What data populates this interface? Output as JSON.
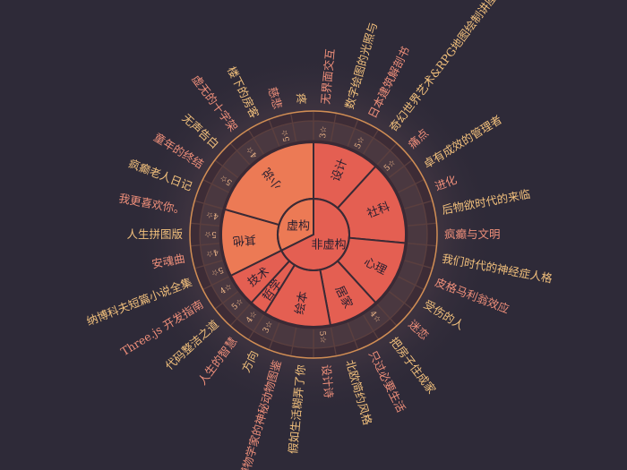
{
  "colors": {
    "background": "#2e2a38",
    "fiction": "#ec7a55",
    "nonfiction": "#e45f52",
    "label_warm": "#f2c07c",
    "label_pink": "#ef8f7a",
    "ring": "#5a3f3f",
    "ring_border": "#f0a35a",
    "star_text": "#f2b98a",
    "inner_divider": "#3a2a35"
  },
  "chart_data": {
    "type": "sunburst",
    "root": {
      "name": "",
      "children": [
        {
          "name": "虚构",
          "children": [
            {
              "name": "其他",
              "children": [
                {
                  "name": "纳博科夫短篇小说全集",
                  "rating": "5☆"
                },
                {
                  "name": "安魂曲",
                  "rating": "4☆"
                },
                {
                  "name": "人生拼图版",
                  "rating": "5☆"
                },
                {
                  "name": "我更喜欢你。",
                  "rating": "4☆"
                }
              ]
            },
            {
              "name": "小说",
              "children": [
                {
                  "name": "疯癫老人日记",
                  "rating": ""
                },
                {
                  "name": "童年的终结",
                  "rating": "5☆"
                },
                {
                  "name": "无声告白",
                  "rating": ""
                },
                {
                  "name": "虚无的十字架",
                  "rating": "4☆"
                },
                {
                  "name": "楼下的房客",
                  "rating": ""
                },
                {
                  "name": "慈悲",
                  "rating": "5☆"
                },
                {
                  "name": "疼",
                  "rating": ""
                }
              ]
            }
          ]
        },
        {
          "name": "非虚构",
          "children": [
            {
              "name": "设计",
              "children": [
                {
                  "name": "无界面交互",
                  "rating": "3☆"
                },
                {
                  "name": "数字绘图的光照与",
                  "rating": ""
                },
                {
                  "name": "日本建筑解剖书",
                  "rating": "5☆"
                },
                {
                  "name": "奇幻世界艺术&RPG地图绘制讲座",
                  "rating": ""
                }
              ]
            },
            {
              "name": "社科",
              "children": [
                {
                  "name": "痛点",
                  "rating": "5☆"
                },
                {
                  "name": "卓有成效的管理者",
                  "rating": ""
                },
                {
                  "name": "进化",
                  "rating": ""
                },
                {
                  "name": "后物欲时代的来临",
                  "rating": ""
                },
                {
                  "name": "疯癫与文明",
                  "rating": ""
                }
              ]
            },
            {
              "name": "心理",
              "children": [
                {
                  "name": "我们时代的神经症人格",
                  "rating": ""
                },
                {
                  "name": "皮格马利翁效应",
                  "rating": ""
                },
                {
                  "name": "受伤的人",
                  "rating": ""
                },
                {
                  "name": "迷恋",
                  "rating": ""
                }
              ]
            },
            {
              "name": "居家",
              "children": [
                {
                  "name": "把房子住成家",
                  "rating": "4☆"
                },
                {
                  "name": "只过必要生活",
                  "rating": ""
                },
                {
                  "name": "北欧简约风格",
                  "rating": ""
                }
              ]
            },
            {
              "name": "绘本",
              "children": [
                {
                  "name": "设计诗",
                  "rating": "5☆"
                },
                {
                  "name": "假如生活糊弄了你",
                  "rating": ""
                },
                {
                  "name": "博物学家的神秘动物图鉴",
                  "rating": ""
                },
                {
                  "name": "方向",
                  "rating": "3☆"
                }
              ]
            },
            {
              "name": "哲学",
              "children": [
                {
                  "name": "人生的智慧",
                  "rating": "4☆"
                }
              ]
            },
            {
              "name": "技术",
              "children": [
                {
                  "name": "代码整洁之道",
                  "rating": "5☆"
                },
                {
                  "name": "Three.js 开发指南",
                  "rating": "4☆"
                }
              ]
            }
          ]
        }
      ]
    }
  }
}
